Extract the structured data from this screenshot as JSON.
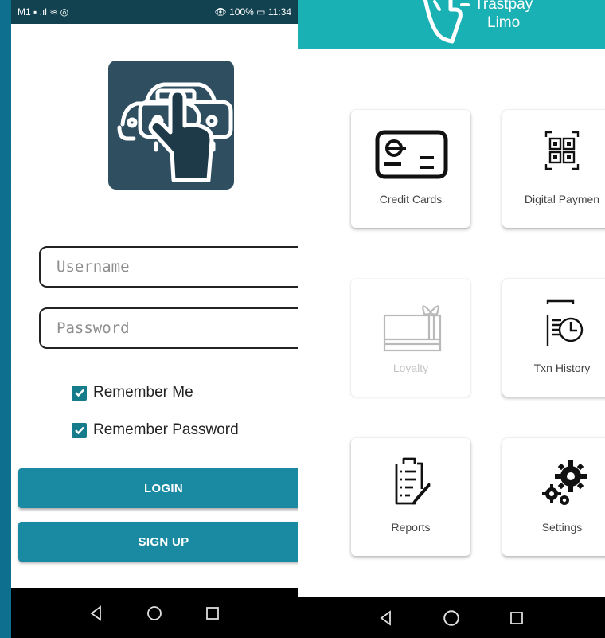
{
  "login_screen": {
    "status_bar": {
      "left": "M1",
      "right": "100%",
      "time": "11:34"
    },
    "username_placeholder": "Username",
    "password_placeholder": "Password",
    "remember_me": {
      "label": "Remember Me",
      "checked": true
    },
    "remember_password": {
      "label": "Remember Password",
      "checked": true
    },
    "login_button": "LOGIN",
    "signup_button": "SIGN UP"
  },
  "menu_screen": {
    "header_title_line1": "Trastpay",
    "header_title_line2": "Limo",
    "tiles": [
      {
        "label": "Credit Cards",
        "icon": "credit-card-icon",
        "enabled": true
      },
      {
        "label": "Digital Paymen",
        "icon": "qr-code-icon",
        "enabled": true
      },
      {
        "label": "Loyalty",
        "icon": "gift-card-icon",
        "enabled": false
      },
      {
        "label": "Txn History",
        "icon": "history-icon",
        "enabled": true
      },
      {
        "label": "Reports",
        "icon": "report-icon",
        "enabled": true
      },
      {
        "label": "Settings",
        "icon": "gears-icon",
        "enabled": true
      }
    ]
  },
  "colors": {
    "brand_teal": "#1ab1b5",
    "button": "#1a8aa2",
    "checkbox": "#167c8b",
    "logo_tile": "#2f4f61",
    "background": "#0f6f8e"
  }
}
